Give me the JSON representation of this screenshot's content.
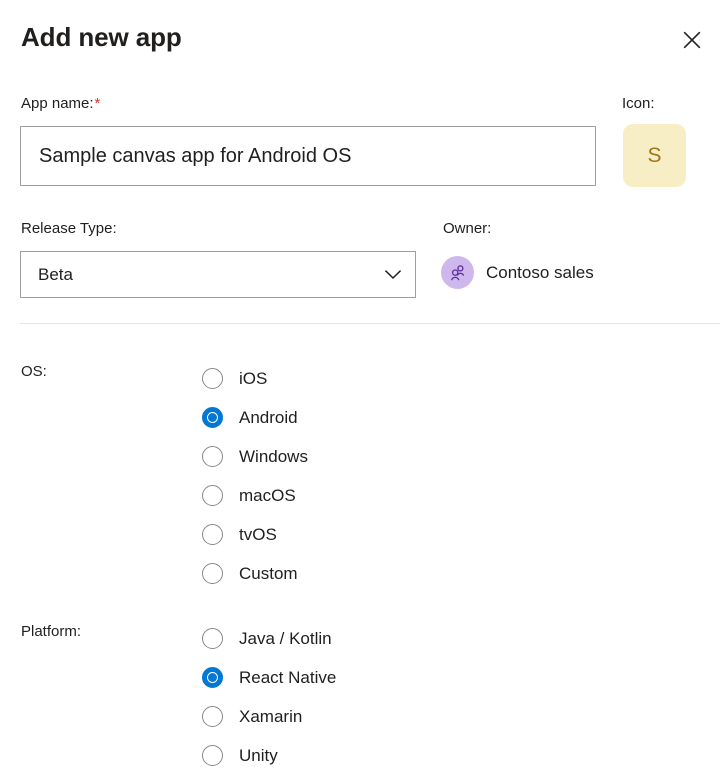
{
  "dialog": {
    "title": "Add new app",
    "close_icon": "close-icon"
  },
  "app_name": {
    "label": "App name:",
    "required_marker": "*",
    "value": "Sample canvas app for Android OS",
    "placeholder": "App name"
  },
  "icon": {
    "label": "Icon:",
    "letter": "S",
    "background_color": "#f7eec6",
    "text_color": "#9a7a18"
  },
  "release_type": {
    "label": "Release Type:",
    "selected": "Beta",
    "options": [
      "Beta"
    ],
    "chevron_icon": "chevron-down-icon"
  },
  "owner": {
    "label": "Owner:",
    "name": "Contoso sales",
    "avatar_icon": "people-group-icon",
    "avatar_background": "#cdb7ec",
    "avatar_glyph_color": "#5b2d9e"
  },
  "os": {
    "label": "OS:",
    "selected": "Android",
    "options": [
      {
        "label": "iOS",
        "selected": false
      },
      {
        "label": "Android",
        "selected": true
      },
      {
        "label": "Windows",
        "selected": false
      },
      {
        "label": "macOS",
        "selected": false
      },
      {
        "label": "tvOS",
        "selected": false
      },
      {
        "label": "Custom",
        "selected": false
      }
    ]
  },
  "platform": {
    "label": "Platform:",
    "selected": "React Native",
    "options": [
      {
        "label": "Java / Kotlin",
        "selected": false
      },
      {
        "label": "React Native",
        "selected": true
      },
      {
        "label": "Xamarin",
        "selected": false
      },
      {
        "label": "Unity",
        "selected": false
      }
    ]
  },
  "theme": {
    "accent_color": "#0078d4",
    "required_color": "#d13438",
    "border_color": "#a19f9d",
    "divider_color": "#e6e6e6",
    "text_color": "#201f1e"
  }
}
